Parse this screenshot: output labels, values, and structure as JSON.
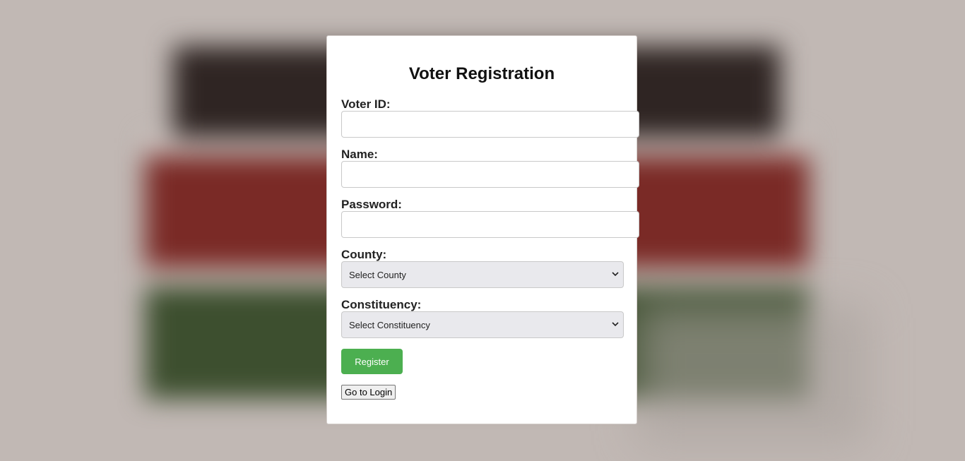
{
  "form": {
    "title": "Voter Registration",
    "voter_id_label": "Voter ID:",
    "voter_id_value": "",
    "name_label": "Name:",
    "name_value": "",
    "password_label": "Password:",
    "password_value": "",
    "county_label": "County:",
    "county_selected": "Select County",
    "constituency_label": "Constituency:",
    "constituency_selected": "Select Constituency",
    "register_label": "Register",
    "login_label": "Go to Login"
  },
  "colors": {
    "register_button": "#4caf50",
    "background": "#c1b8b4",
    "card": "#ffffff"
  },
  "icons": {
    "select_indicator": "chevron-down-icon"
  }
}
